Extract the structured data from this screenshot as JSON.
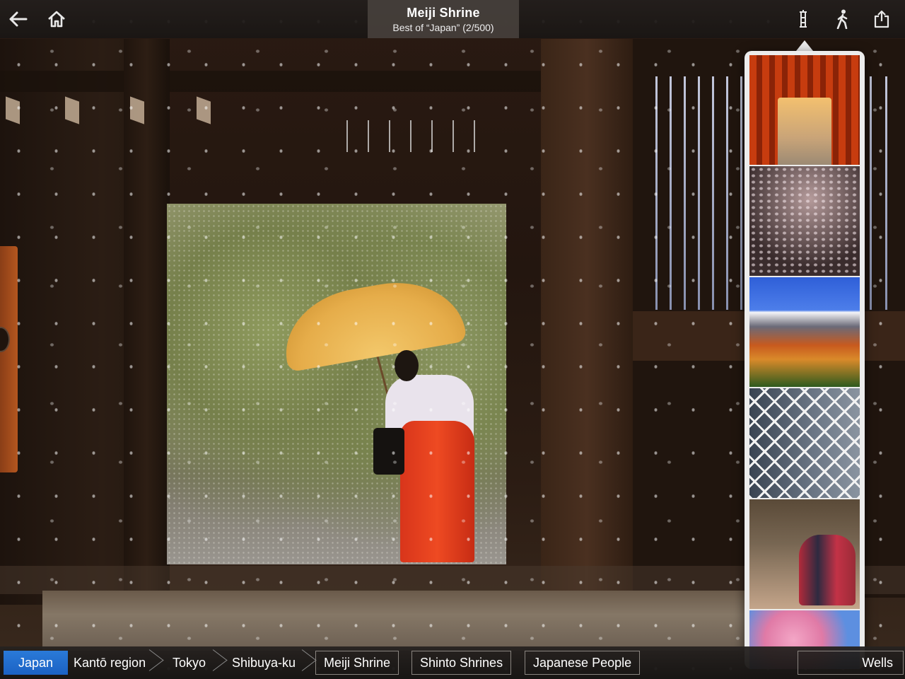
{
  "header": {
    "title": "Meiji Shrine",
    "subtitle": "Best of “Japan” (2/500)"
  },
  "toolbar": {
    "back_icon": "arrow-left-icon",
    "home_icon": "home-icon",
    "tower_icon": "tower-icon",
    "walk_icon": "walking-person-icon",
    "share_icon": "share-icon"
  },
  "thumbnails": [
    {
      "name": "torii-gates"
    },
    {
      "name": "castle-cherry-blossoms"
    },
    {
      "name": "mount-fuji"
    },
    {
      "name": "cocoon-tower"
    },
    {
      "name": "kimono-street"
    },
    {
      "name": "cherry-blossoms"
    }
  ],
  "breadcrumbs": {
    "items": [
      "Japan",
      "Kantō region",
      "Tokyo",
      "Shibuya-ku"
    ],
    "chips": [
      "Meiji Shrine",
      "Shinto Shrines",
      "Japanese People"
    ],
    "overflow_chip": "Wells"
  },
  "colors": {
    "accent": "#1b62c4",
    "skirt": "#e43e1f",
    "umbrella": "#e6ad4a"
  }
}
